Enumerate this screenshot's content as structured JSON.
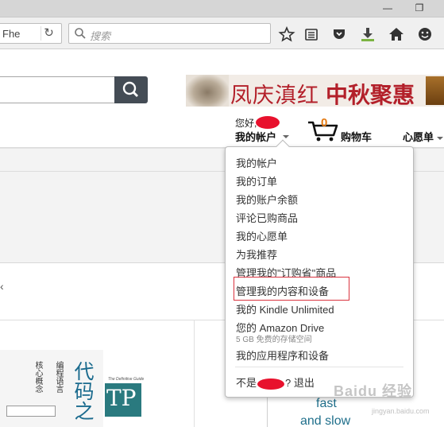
{
  "browser": {
    "url_fragment": "F​he",
    "url_text": "Fhe",
    "search_placeholder": "搜索",
    "icons": [
      "reload-icon",
      "search-icon",
      "bookmark-star-icon",
      "reading-list-icon",
      "pocket-icon",
      "download-icon",
      "home-icon",
      "smiley-icon"
    ]
  },
  "header": {
    "banner_text_1": "凤庆滇红",
    "banner_text_2": "中秋聚惠",
    "greeting": "您好,",
    "account_label": "我的帐户",
    "cart_count": "0",
    "cart_label": "购物车",
    "wishlist_label": "心愿单"
  },
  "dropdown": {
    "items": [
      "我的帐户",
      "我的订单",
      "我的账户余额",
      "评论已购商品",
      "我的心愿单",
      "为我推荐",
      "管理我的\"订购省\"商品",
      "管理我的内容和设备",
      "我的 Kindle Unlimited",
      "您的 Amazon Drive",
      "我的应用程序和设备"
    ],
    "drive_sub": "5 GB 免费的存储空间",
    "signout_prefix": "不是",
    "signout_suffix": "? 退出"
  },
  "content": {
    "arrow": "‹",
    "book1_col1": "核心概念",
    "book1_col2": "编程语言",
    "book1_big": "代码之",
    "book2_tagline": "The Definitive Guide",
    "book2_title": "TP",
    "fast": "fast",
    "and_slow": "and slow"
  },
  "watermark": {
    "main": "Baidu 经验",
    "sub": "jingyan.baidu.com"
  },
  "colors": {
    "accent_red": "#d9333f",
    "amazon_orange": "#e47911",
    "banner_red": "#b3202a"
  }
}
